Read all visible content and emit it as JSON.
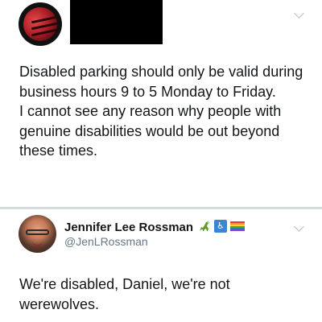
{
  "tweets": [
    {
      "text": "Disabled parking should only be valid during business hours 9 to 5 Monday to Friday.\nI cannot see any reason why people with genuine disabilities would be out beyond these times."
    },
    {
      "author_name": "Jennifer Lee Rossman",
      "handle": "@JenLRossman",
      "name_emojis": [
        "dinosaur-icon",
        "disability-icon",
        "rainbow-flag-icon"
      ],
      "text": "We're disabled, Daniel, we're not werewolves."
    }
  ],
  "colors": {
    "text": "#14171a",
    "handle": "#657786",
    "divider": "#d7dbe0",
    "redaction": "#000000"
  }
}
